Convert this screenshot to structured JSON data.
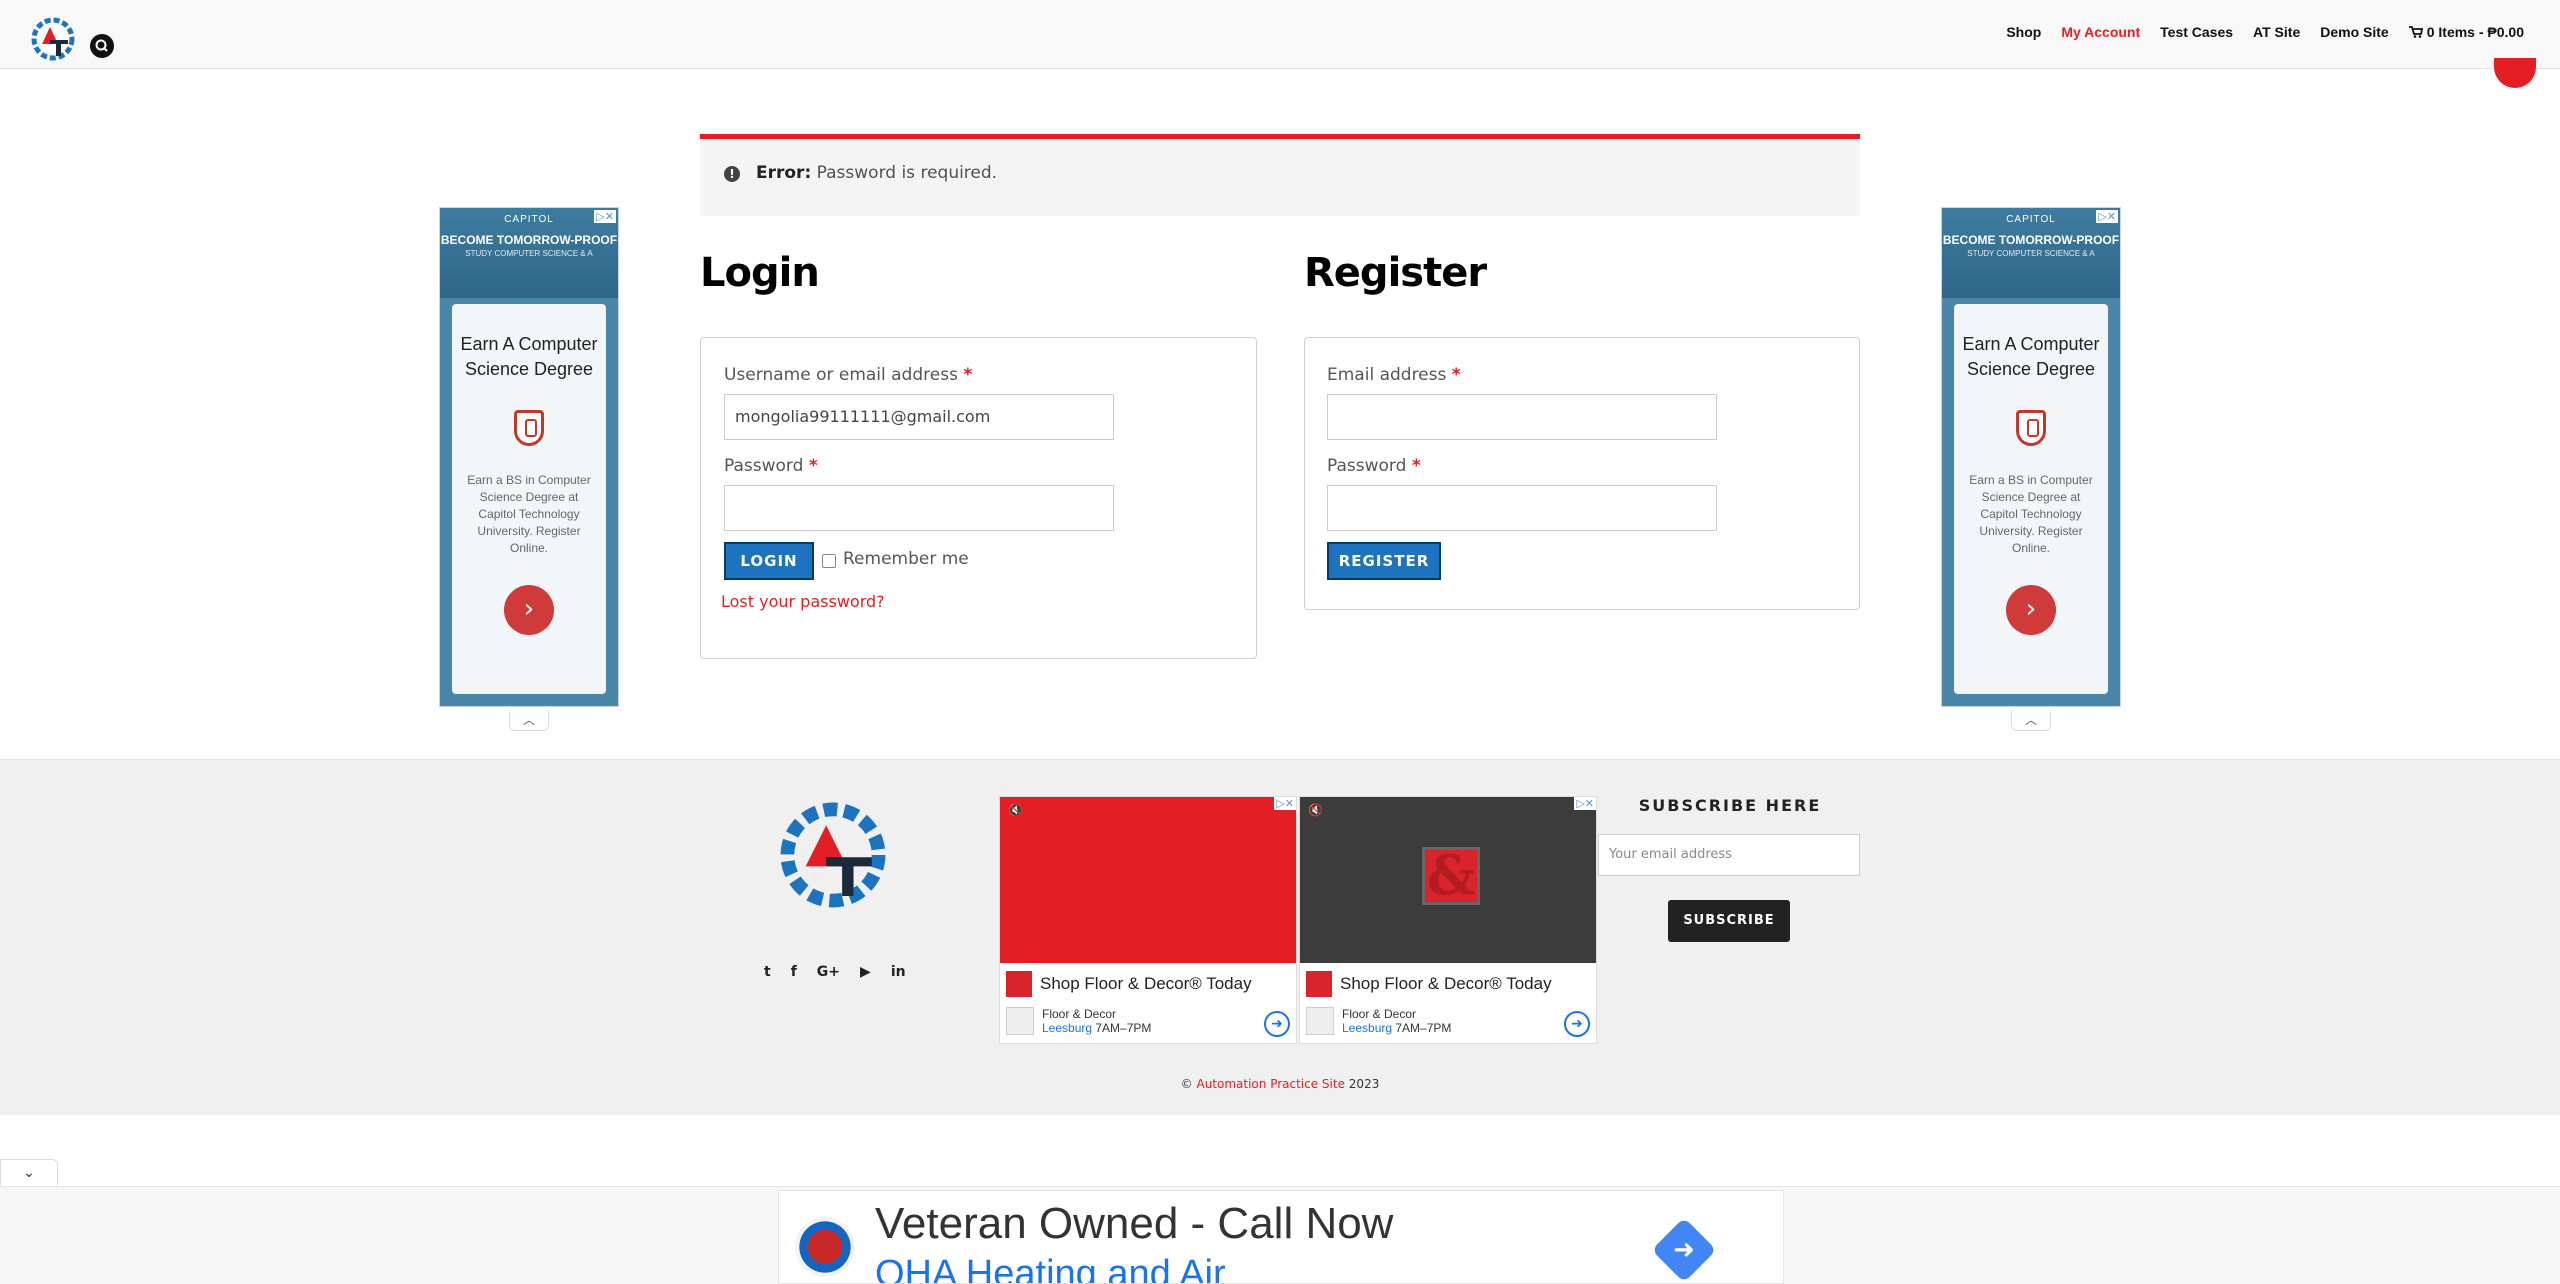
{
  "header": {
    "nav": [
      {
        "label": "Shop",
        "active": false
      },
      {
        "label": "My Account",
        "active": true
      },
      {
        "label": "Test Cases",
        "active": false
      },
      {
        "label": "AT Site",
        "active": false
      },
      {
        "label": "Demo Site",
        "active": false
      }
    ],
    "cart_label": "0 Items - ₱0.00",
    "icons": {
      "search": "search-icon",
      "cart": "cart-icon",
      "logo": "automation-testing-logo"
    }
  },
  "error": {
    "prefix": "Error:",
    "message": " Password is required."
  },
  "login": {
    "title": "Login",
    "username_label": "Username or email address",
    "username_value": "mongolia99111111@gmail.com",
    "password_label": "Password",
    "button": "LOGIN",
    "remember_label": "Remember me",
    "lost_password": "Lost your password?",
    "required_mark": "*"
  },
  "register": {
    "title": "Register",
    "email_label": "Email address",
    "password_label": "Password",
    "button": "REGISTER",
    "required_mark": "*"
  },
  "side_ad": {
    "cap": "CAPITOL",
    "big": "BECOME TOMORROW-PROOF",
    "small": "STUDY COMPUTER SCIENCE & A",
    "title": "Earn A Computer Science Degree",
    "desc": "Earn a BS in Computer Science Degree at Capitol Technology University. Register Online.",
    "go": "›",
    "close": "▷✕",
    "collapse": "︿"
  },
  "footer": {
    "socials": [
      "t",
      "f",
      "G+",
      "▶",
      "in"
    ],
    "video_ads": [
      {
        "headline": "Shop Floor & Decor® Today",
        "brand": "Floor & Decor",
        "location": "Leesburg",
        "hours": " 7AM–7PM",
        "bg": "#e31e24",
        "mute": "🔇"
      },
      {
        "headline": "Shop Floor & Decor® Today",
        "brand": "Floor & Decor",
        "location": "Leesburg",
        "hours": " 7AM–7PM",
        "bg": "#3c3c3c",
        "mute": "🔇",
        "logo_glyph": "&"
      }
    ],
    "subscribe_title": "SUBSCRIBE HERE",
    "subscribe_placeholder": "Your email address",
    "subscribe_button": "SUBSCRIBE",
    "copyright_symbol": "© ",
    "copyright_link": "Automation Practice Site",
    "copyright_year": " 2023"
  },
  "sticky_ad": {
    "toggle": "⌄",
    "headline": "Veteran Owned - Call Now",
    "sub": "OHA Heating and Air",
    "arrow": "➜"
  },
  "colors": {
    "accent": "#e31e24",
    "button_blue": "#1e73be",
    "footer_bg": "#f0f0f0"
  }
}
